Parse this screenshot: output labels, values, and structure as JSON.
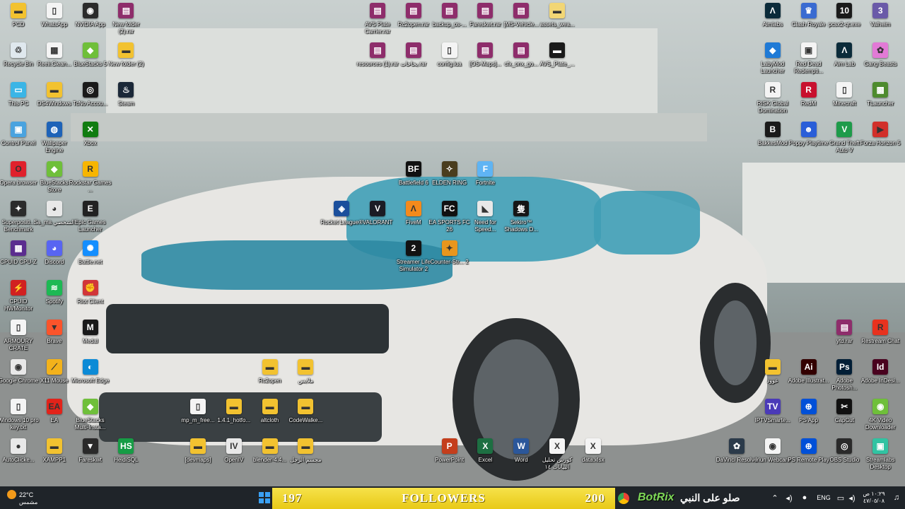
{
  "desktop": {
    "icons": [
      {
        "label": "PCD",
        "x": 0,
        "y": 0,
        "color": "#f2c230",
        "glyph": "▬"
      },
      {
        "label": "WhatsApp",
        "x": 1,
        "y": 0,
        "color": "#f4f4f4",
        "glyph": "▯"
      },
      {
        "label": "NVIDIA App",
        "x": 2,
        "y": 0,
        "color": "#2b2b2b",
        "glyph": "◉"
      },
      {
        "label": "New folder (2).rar",
        "x": 3,
        "y": 0,
        "color": "#8e2d6b",
        "glyph": "▤"
      },
      {
        "label": "Recycle Bin",
        "x": 0,
        "y": 1,
        "color": "#dfe8ee",
        "glyph": "♲"
      },
      {
        "label": "Reeii.Clean...",
        "x": 1,
        "y": 1,
        "color": "#f4f4f4",
        "glyph": "▦"
      },
      {
        "label": "BlueStacks 5",
        "x": 2,
        "y": 1,
        "color": "#6fbf3a",
        "glyph": "◆"
      },
      {
        "label": "New folder (2)",
        "x": 3,
        "y": 1,
        "color": "#f2c230",
        "glyph": "▬"
      },
      {
        "label": "This PC",
        "x": 0,
        "y": 2,
        "color": "#3bb5e6",
        "glyph": "▭"
      },
      {
        "label": "DS4Windows",
        "x": 1,
        "y": 2,
        "color": "#f2c230",
        "glyph": "▬"
      },
      {
        "label": "TcNo Accou...",
        "x": 2,
        "y": 2,
        "color": "#1a1a1a",
        "glyph": "◎"
      },
      {
        "label": "Steam",
        "x": 3,
        "y": 2,
        "color": "#1b2838",
        "glyph": "♨"
      },
      {
        "label": "Control Panel",
        "x": 0,
        "y": 3,
        "color": "#4aa3df",
        "glyph": "▣"
      },
      {
        "label": "Wallpaper Engine",
        "x": 1,
        "y": 3,
        "color": "#1e63b8",
        "glyph": "◍"
      },
      {
        "label": "Xbox",
        "x": 2,
        "y": 3,
        "color": "#107c10",
        "glyph": "✕"
      },
      {
        "label": "Opera browser",
        "x": 0,
        "y": 4,
        "color": "#e0212c",
        "glyph": "O"
      },
      {
        "label": "BlueStacks Store",
        "x": 1,
        "y": 4,
        "color": "#6fbf3a",
        "glyph": "◆"
      },
      {
        "label": "Rockstar Games ...",
        "x": 2,
        "y": 4,
        "color": "#f7b500",
        "glyph": "R"
      },
      {
        "label": "Superpositi... Benchmark",
        "x": 0,
        "y": 5,
        "color": "#2b2b2b",
        "glyph": "✦"
      },
      {
        "label": "Sa_ma الشخصي",
        "x": 1,
        "y": 5,
        "color": "#e8e8e8",
        "glyph": "◕"
      },
      {
        "label": "Epic Games Launcher",
        "x": 2,
        "y": 5,
        "color": "#222222",
        "glyph": "E"
      },
      {
        "label": "CPUID CPU-Z",
        "x": 0,
        "y": 6,
        "color": "#5b2d8f",
        "glyph": "▦"
      },
      {
        "label": "Discord",
        "x": 1,
        "y": 6,
        "color": "#5865f2",
        "glyph": "◕"
      },
      {
        "label": "Battle.net",
        "x": 2,
        "y": 6,
        "color": "#148eff",
        "glyph": "✺"
      },
      {
        "label": "CPUID HWMonitor",
        "x": 0,
        "y": 7,
        "color": "#d12020",
        "glyph": "⚡"
      },
      {
        "label": "Spotify",
        "x": 1,
        "y": 7,
        "color": "#1db954",
        "glyph": "≋"
      },
      {
        "label": "Riot Client",
        "x": 2,
        "y": 7,
        "color": "#d13639",
        "glyph": "✊"
      },
      {
        "label": "ARMOURY CRATE",
        "x": 0,
        "y": 8,
        "color": "#f4f4f4",
        "glyph": "▯"
      },
      {
        "label": "Brave",
        "x": 1,
        "y": 8,
        "color": "#fb542b",
        "glyph": "▼"
      },
      {
        "label": "Medal",
        "x": 2,
        "y": 8,
        "color": "#1a1a1a",
        "glyph": "M"
      },
      {
        "label": "Google Chrome",
        "x": 0,
        "y": 9,
        "color": "#e8e8e8",
        "glyph": "◉"
      },
      {
        "label": "X11 Mouse",
        "x": 1,
        "y": 9,
        "color": "#f3b21b",
        "glyph": "⟋"
      },
      {
        "label": "Microsoft Edge",
        "x": 2,
        "y": 9,
        "color": "#0c8ad6",
        "glyph": "◐"
      },
      {
        "label": "Windows 10 pro key.txt",
        "x": 0,
        "y": 10,
        "color": "#f4f4f4",
        "glyph": "▯"
      },
      {
        "label": "EA",
        "x": 1,
        "y": 10,
        "color": "#e2231a",
        "glyph": "EA"
      },
      {
        "label": "BlueStacks Multi-Insta...",
        "x": 2,
        "y": 10,
        "color": "#6fbf3a",
        "glyph": "◆"
      },
      {
        "label": "AutoClicke...",
        "x": 0,
        "y": 11,
        "color": "#e8e8e8",
        "glyph": "●"
      },
      {
        "label": "XAMPP1",
        "x": 1,
        "y": 11,
        "color": "#f2c230",
        "glyph": "▬"
      },
      {
        "label": "Fareskwt",
        "x": 2,
        "y": 11,
        "color": "#2a2a2a",
        "glyph": "▼"
      },
      {
        "label": "HeidiSQL",
        "x": 3,
        "y": 11,
        "color": "#169c45",
        "glyph": "HS"
      },
      {
        "label": "AVS Plate Carrier.rar",
        "x": 10,
        "y": 0,
        "color": "#8e2d6b",
        "glyph": "▤"
      },
      {
        "label": "Rc2open.rar",
        "x": 11,
        "y": 0,
        "color": "#8e2d6b",
        "glyph": "▤"
      },
      {
        "label": "backup_os-...",
        "x": 12,
        "y": 0,
        "color": "#8e2d6b",
        "glyph": "▤"
      },
      {
        "label": "Fareskwt.rar",
        "x": 13,
        "y": 0,
        "color": "#8e2d6b",
        "glyph": "▤"
      },
      {
        "label": "[MS-Vehicle...",
        "x": 14,
        "y": 0,
        "color": "#8e2d6b",
        "glyph": "▤"
      },
      {
        "label": "assets_wea...",
        "x": 15,
        "y": 0,
        "color": "#f2d675",
        "glyph": "▬"
      },
      {
        "label": "resources (1).rar",
        "x": 10,
        "y": 1,
        "color": "#8e2d6b",
        "glyph": "▤"
      },
      {
        "label": "بخاخات.rar",
        "x": 11,
        "y": 1,
        "color": "#8e2d6b",
        "glyph": "▤"
      },
      {
        "label": "config.lua",
        "x": 12,
        "y": 1,
        "color": "#f4f4f4",
        "glyph": "▯"
      },
      {
        "label": "[OS-Maps]...",
        "x": 13,
        "y": 1,
        "color": "#8e2d6b",
        "glyph": "▤"
      },
      {
        "label": "cfx_onx_go...",
        "x": 14,
        "y": 1,
        "color": "#8e2d6b",
        "glyph": "▤"
      },
      {
        "label": "AVS_Plate_...",
        "x": 15,
        "y": 1,
        "color": "#1a1a1a",
        "glyph": "▬"
      },
      {
        "label": "Battlefield 6",
        "x": 11,
        "y": 4,
        "color": "#101010",
        "glyph": "BF"
      },
      {
        "label": "ELDEN RING",
        "x": 12,
        "y": 4,
        "color": "#4a3d1e",
        "glyph": "✧"
      },
      {
        "label": "Fortnite",
        "x": 13,
        "y": 4,
        "color": "#5fb4f4",
        "glyph": "F"
      },
      {
        "label": "Rocket League®",
        "x": 9,
        "y": 5,
        "color": "#1b4f9c",
        "glyph": "◈"
      },
      {
        "label": "VALORANT",
        "x": 10,
        "y": 5,
        "color": "#1b1b24",
        "glyph": "V"
      },
      {
        "label": "FiveM",
        "x": 11,
        "y": 5,
        "color": "#f48a1c",
        "glyph": "Λ"
      },
      {
        "label": "EA SPORTS FC 26",
        "x": 12,
        "y": 5,
        "color": "#111111",
        "glyph": "FC"
      },
      {
        "label": "Need for Speed...",
        "x": 13,
        "y": 5,
        "color": "#e8e8e8",
        "glyph": "◣"
      },
      {
        "label": "Sekiro™ Shadows D...",
        "x": 14,
        "y": 5,
        "color": "#161616",
        "glyph": "隻"
      },
      {
        "label": "Streamer Life Simulator 2",
        "x": 11,
        "y": 6,
        "color": "#121212",
        "glyph": "2"
      },
      {
        "label": "Counter-Str... 2",
        "x": 12,
        "y": 6,
        "color": "#e8961e",
        "glyph": "✦"
      },
      {
        "label": "Rc2open",
        "x": 7,
        "y": 9,
        "color": "#f2c230",
        "glyph": "▬"
      },
      {
        "label": "ملابس",
        "x": 8,
        "y": 9,
        "color": "#f2c230",
        "glyph": "▬"
      },
      {
        "label": "mp_m_free...",
        "x": 5,
        "y": 10,
        "color": "#f4f4f4",
        "glyph": "▯"
      },
      {
        "label": "1.4.1_hotfo...",
        "x": 6,
        "y": 10,
        "color": "#f2c230",
        "glyph": "▬"
      },
      {
        "label": "altcloth",
        "x": 7,
        "y": 10,
        "color": "#f2c230",
        "glyph": "▬"
      },
      {
        "label": "CodeWalke...",
        "x": 8,
        "y": 10,
        "color": "#f2c230",
        "glyph": "▬"
      },
      {
        "label": "[devmaps]",
        "x": 5,
        "y": 11,
        "color": "#f2c230",
        "glyph": "▬"
      },
      {
        "label": "OpenIV",
        "x": 6,
        "y": 11,
        "color": "#e8e8e8",
        "glyph": "IV"
      },
      {
        "label": "blender-4.4...",
        "x": 7,
        "y": 11,
        "color": "#f2c230",
        "glyph": "▬"
      },
      {
        "label": "مجسم الرجل",
        "x": 8,
        "y": 11,
        "color": "#f2c230",
        "glyph": "▬"
      },
      {
        "label": "PowerPoint",
        "x": 12,
        "y": 11,
        "color": "#c43e1c",
        "glyph": "P"
      },
      {
        "label": "Excel",
        "x": 13,
        "y": 11,
        "color": "#1d6f42",
        "glyph": "X"
      },
      {
        "label": "Word",
        "x": 14,
        "y": 11,
        "color": "#2b579a",
        "glyph": "W"
      },
      {
        "label": "كورس تحليل البيانات ١٤",
        "x": 15,
        "y": 11,
        "color": "#f4f4f4",
        "glyph": "X"
      },
      {
        "label": "data.xlsx",
        "x": 16,
        "y": 11,
        "color": "#f4f4f4",
        "glyph": "X"
      },
      {
        "label": "Aimlabs",
        "x": 21,
        "y": 0,
        "color": "#0b2b3a",
        "glyph": "Λ"
      },
      {
        "label": "Clash Royale",
        "x": 22,
        "y": 0,
        "color": "#3a6bd1",
        "glyph": "♛"
      },
      {
        "label": "pcsx2-qt.exe",
        "x": 23,
        "y": 0,
        "color": "#1a1a1a",
        "glyph": "10"
      },
      {
        "label": "Valheim",
        "x": 24,
        "y": 0,
        "color": "#6a5aa8",
        "glyph": "3"
      },
      {
        "label": "LabyMod Launcher",
        "x": 21,
        "y": 1,
        "color": "#1f7ad6",
        "glyph": "◆"
      },
      {
        "label": "Red Dead Redempti...",
        "x": 22,
        "y": 1,
        "color": "#f4f4f4",
        "glyph": "▣"
      },
      {
        "label": "Aim Lab",
        "x": 23,
        "y": 1,
        "color": "#0b2b3a",
        "glyph": "Λ"
      },
      {
        "label": "Gang Beasts",
        "x": 24,
        "y": 1,
        "color": "#e27ad6",
        "glyph": "✿"
      },
      {
        "label": "RISK Global Domination",
        "x": 21,
        "y": 2,
        "color": "#f4f4f4",
        "glyph": "R"
      },
      {
        "label": "RedM",
        "x": 22,
        "y": 2,
        "color": "#c8102e",
        "glyph": "R"
      },
      {
        "label": "Minecraft",
        "x": 23,
        "y": 2,
        "color": "#f4f4f4",
        "glyph": "▯"
      },
      {
        "label": "TLauncher",
        "x": 24,
        "y": 2,
        "color": "#4e8b2e",
        "glyph": "▩"
      },
      {
        "label": "BakkesMod",
        "x": 21,
        "y": 3,
        "color": "#1a1a1a",
        "glyph": "B"
      },
      {
        "label": "Poppy Playtime",
        "x": 22,
        "y": 3,
        "color": "#2a5ed8",
        "glyph": "☻"
      },
      {
        "label": "Grand Theft Auto V",
        "x": 23,
        "y": 3,
        "color": "#1e9b4a",
        "glyph": "V"
      },
      {
        "label": "Forza Horizon 5",
        "x": 24,
        "y": 3,
        "color": "#d12f2a",
        "glyph": "▶"
      },
      {
        "label": "ytd.rar",
        "x": 23,
        "y": 8,
        "color": "#8e2d6b",
        "glyph": "▤"
      },
      {
        "label": "Restream Chat",
        "x": 24,
        "y": 8,
        "color": "#e8321e",
        "glyph": "R"
      },
      {
        "label": "عوود",
        "x": 21,
        "y": 9,
        "color": "#f2c230",
        "glyph": "▬"
      },
      {
        "label": "Adobe Illustrat...",
        "x": 22,
        "y": 9,
        "color": "#330000",
        "glyph": "Ai"
      },
      {
        "label": "Adobe Photosh...",
        "x": 23,
        "y": 9,
        "color": "#001e36",
        "glyph": "Ps"
      },
      {
        "label": "Adobe InDesi...",
        "x": 24,
        "y": 9,
        "color": "#49021f",
        "glyph": "Id"
      },
      {
        "label": "IPTVSmarte...",
        "x": 21,
        "y": 10,
        "color": "#4a3ab8",
        "glyph": "TV"
      },
      {
        "label": "PS App",
        "x": 22,
        "y": 10,
        "color": "#0050d8",
        "glyph": "⊕"
      },
      {
        "label": "CapCut",
        "x": 23,
        "y": 10,
        "color": "#111111",
        "glyph": "✂"
      },
      {
        "label": "4K Video Downloader",
        "x": 24,
        "y": 10,
        "color": "#6fbf3a",
        "glyph": "◉"
      },
      {
        "label": "DaVinci Resolve",
        "x": 20,
        "y": 11,
        "color": "#2b3a4a",
        "glyph": "✿"
      },
      {
        "label": "Iriun Webcam",
        "x": 21,
        "y": 11,
        "color": "#f4f4f4",
        "glyph": "◉"
      },
      {
        "label": "PS Remote Play",
        "x": 22,
        "y": 11,
        "color": "#0050d8",
        "glyph": "⊕"
      },
      {
        "label": "OBS Studio",
        "x": 23,
        "y": 11,
        "color": "#2a2a2a",
        "glyph": "◎"
      },
      {
        "label": "Streamlabs Desktop",
        "x": 24,
        "y": 11,
        "color": "#31c3a2",
        "glyph": "▣"
      }
    ]
  },
  "taskbar": {
    "weather_temp": "22°C",
    "weather_text": "مشمس",
    "followers_left": "197",
    "followers_label": "FOLLOWERS",
    "followers_right": "200",
    "botrix": "BotRix",
    "chat_text": "صلو على النبي",
    "language": "ENG",
    "time": "١٠:٢٩ ص",
    "date": "٤٧/٠٥/٠٨"
  }
}
